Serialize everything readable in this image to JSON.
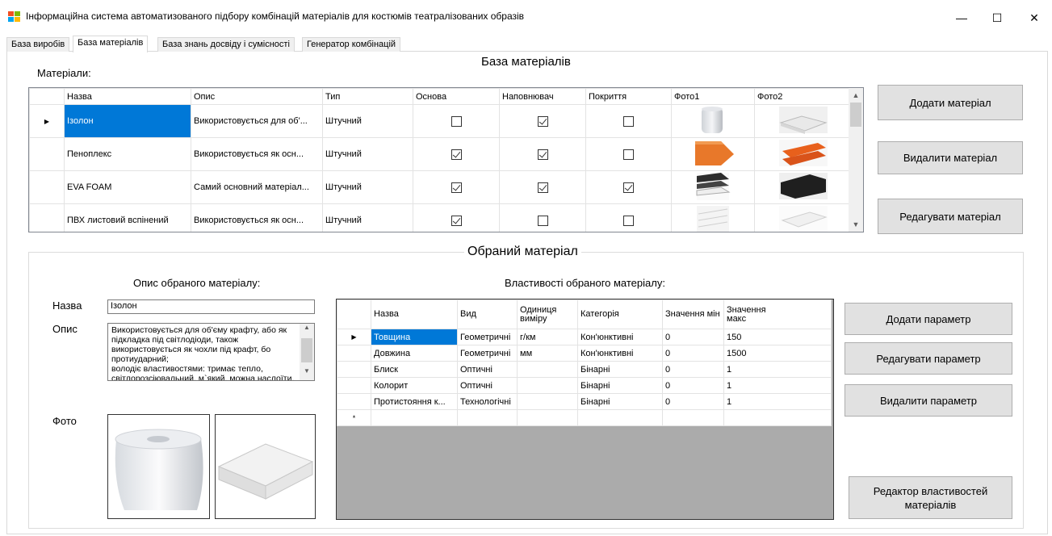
{
  "window": {
    "title": "Інформаційна система автоматизованого підбору комбінацій матеріалів для костюмів театралізованих образів",
    "min_glyph": "—",
    "max_glyph": "☐",
    "close_glyph": "✕"
  },
  "tabs": [
    {
      "label": "База виробів",
      "active": false
    },
    {
      "label": "База матеріалів",
      "active": true
    },
    {
      "label": "База знань досвіду і сумісності",
      "active": false
    },
    {
      "label": "Генератор комбінацій",
      "active": false
    }
  ],
  "page_title": "База матеріалів",
  "materials_label": "Матеріали:",
  "materials_table": {
    "columns": [
      "Назва",
      "Опис",
      "Тип",
      "Основа",
      "Наповнювач",
      "Покриття",
      "Фото1",
      "Фото2"
    ],
    "rows": [
      {
        "name": "Ізолон",
        "desc": "Використовується для об'...",
        "type": "Штучний",
        "base": false,
        "filler": true,
        "coating": false,
        "selected": true
      },
      {
        "name": "Пеноплекс",
        "desc": "Використовується як осн...",
        "type": "Штучний",
        "base": true,
        "filler": true,
        "coating": false,
        "selected": false
      },
      {
        "name": "EVA FOAM",
        "desc": "Самий основний матеріал...",
        "type": "Штучний",
        "base": true,
        "filler": true,
        "coating": true,
        "selected": false
      },
      {
        "name": "ПВХ листовий вспінений",
        "desc": "Використовується як осн...",
        "type": "Штучний",
        "base": true,
        "filler": false,
        "coating": false,
        "selected": false
      }
    ],
    "current_row_marker": "▶"
  },
  "material_buttons": {
    "add": "Додати матеріал",
    "delete": "Видалити матеріал",
    "edit": "Редагувати матеріал"
  },
  "selected_material": {
    "group_title": "Обраний матеріал",
    "desc_heading": "Опис обраного матеріалу:",
    "name_label": "Назва",
    "name_value": "Ізолон",
    "desc_label": "Опис",
    "desc_value": "Використовується для об'єму крафту, або як підкладка під світлодіоди, також використовується як чохли під крафт, бо протиударний;\nволодіє властивостями: тримає тепло, світлорозсіювальний, м`який, можна наслоїти, легкий;",
    "photo_label": "Фото"
  },
  "properties": {
    "heading": "Властивості обраного матеріалу:",
    "columns": [
      "Назва",
      "Вид",
      "Одиниця виміру",
      "Категорія",
      "Значення мін",
      "Значення макс"
    ],
    "rows": [
      {
        "name": "Товщина",
        "kind": "Геометричні",
        "unit": "г/км",
        "category": "Кон'юнктивні",
        "min": "0",
        "max": "150",
        "selected": true
      },
      {
        "name": "Довжина",
        "kind": "Геометричні",
        "unit": "мм",
        "category": "Кон'юнктивні",
        "min": "0",
        "max": "1500",
        "selected": false
      },
      {
        "name": "Блиск",
        "kind": "Оптичні",
        "unit": "",
        "category": "Бінарні",
        "min": "0",
        "max": "1",
        "selected": false
      },
      {
        "name": "Колорит",
        "kind": "Оптичні",
        "unit": "",
        "category": "Бінарні",
        "min": "0",
        "max": "1",
        "selected": false
      },
      {
        "name": "Протистояння к...",
        "kind": "Технологічні",
        "unit": "",
        "category": "Бінарні",
        "min": "0",
        "max": "1",
        "selected": false
      }
    ],
    "new_row_marker": "*"
  },
  "property_buttons": {
    "add": "Додати параметр",
    "edit": "Редагувати параметр",
    "delete": "Видалити параметр",
    "editor": "Редактор властивостей матеріалів"
  },
  "colors": {
    "selection": "#0078d7",
    "button_bg": "#e1e1e1",
    "grid_empty_bg": "#ababab"
  }
}
